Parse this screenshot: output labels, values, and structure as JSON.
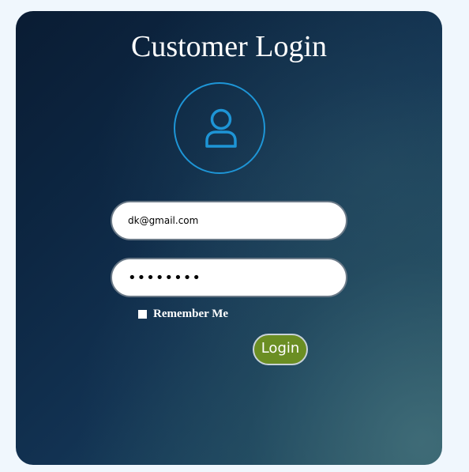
{
  "login_card": {
    "title": "Customer Login",
    "avatar_icon": "user-icon",
    "email_value": "dk@gmail.com",
    "password_value": "••••••••",
    "remember_label": "Remember Me",
    "login_label": "Login"
  },
  "colors": {
    "accent": "#1e95d6",
    "login_button": "#6b8e23",
    "page_background": "#f0f7fd",
    "card_background": "#0d2743"
  }
}
